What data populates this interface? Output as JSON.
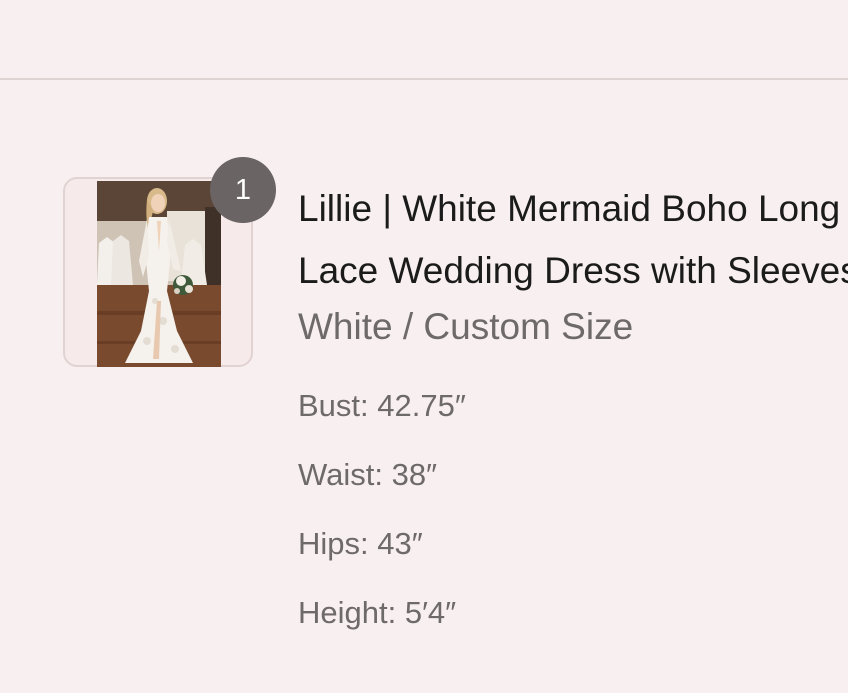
{
  "line_item": {
    "quantity": "1",
    "image_alt": "Bride in a white lace mermaid wedding dress in a bridal shop",
    "title_line1": "Lillie | White Mermaid Boho Long Sleeves",
    "title_line2": "Lace Wedding Dress with Sleeves",
    "variant": "White / Custom Size",
    "properties": [
      "Bust: 42.75″",
      "Waist: 38″",
      "Hips: 43″",
      "Height: 5′4″"
    ]
  },
  "colors": {
    "background": "#f8f0f0",
    "badge": "#6a6464",
    "title_text": "#1b1b1b",
    "secondary_text": "#6f6a6a"
  }
}
